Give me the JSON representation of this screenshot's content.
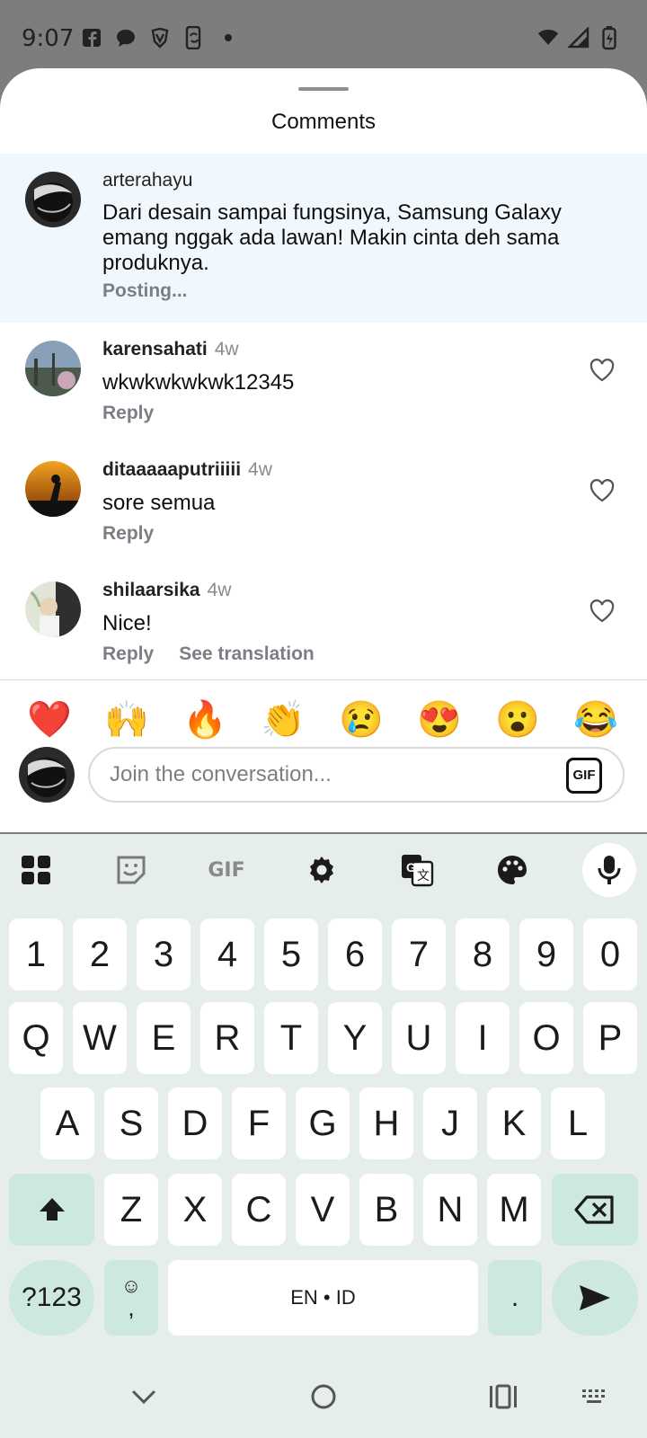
{
  "status_bar": {
    "time": "9:07",
    "icons_left": [
      "facebook-icon",
      "chat-bubble-icon",
      "shield-icon",
      "phone-sync-icon",
      "dot-icon"
    ],
    "icons_right": [
      "wifi-icon",
      "signal-icon",
      "battery-icon"
    ]
  },
  "sheet": {
    "title": "Comments"
  },
  "comments": [
    {
      "username": "arterahayu",
      "ago": "",
      "text": "Dari desain sampai fungsinya, Samsung Galaxy emang nggak ada lawan! Makin cinta deh sama produknya.",
      "status": "Posting..."
    },
    {
      "username": "karensahati",
      "ago": "4w",
      "text": "wkwkwkwkwk12345",
      "reply": "Reply"
    },
    {
      "username": "ditaaaaaputriiiii",
      "ago": "4w",
      "text": "sore semua",
      "reply": "Reply"
    },
    {
      "username": "shilaarsika",
      "ago": "4w",
      "text": "Nice!",
      "reply": "Reply",
      "translate": "See translation"
    }
  ],
  "emoji_reactions": [
    "❤️",
    "🙌",
    "🔥",
    "👏",
    "😢",
    "😍",
    "😮",
    "😂"
  ],
  "composer": {
    "placeholder": "Join the conversation...",
    "gif_label": "GIF"
  },
  "keyboard": {
    "toolbar": [
      "apps-grid-icon",
      "sticker-icon",
      "gif-icon",
      "settings-gear-icon",
      "translate-icon",
      "palette-icon",
      "microphone-icon"
    ],
    "toolbar_gif_label": "GIF",
    "row_numbers": [
      "1",
      "2",
      "3",
      "4",
      "5",
      "6",
      "7",
      "8",
      "9",
      "0"
    ],
    "row_q": [
      "Q",
      "W",
      "E",
      "R",
      "T",
      "Y",
      "U",
      "I",
      "O",
      "P"
    ],
    "row_a": [
      "A",
      "S",
      "D",
      "F",
      "G",
      "H",
      "J",
      "K",
      "L"
    ],
    "row_z": [
      "Z",
      "X",
      "C",
      "V",
      "B",
      "N",
      "M"
    ],
    "symbols_key": "?123",
    "emoji_comma_top": "☺",
    "emoji_comma_bottom": ",",
    "space_label": "EN • ID",
    "period": "."
  },
  "nav_bar": [
    "chevron-down-icon",
    "home-circle-icon",
    "recents-icon",
    "keyboard-switch-icon"
  ]
}
